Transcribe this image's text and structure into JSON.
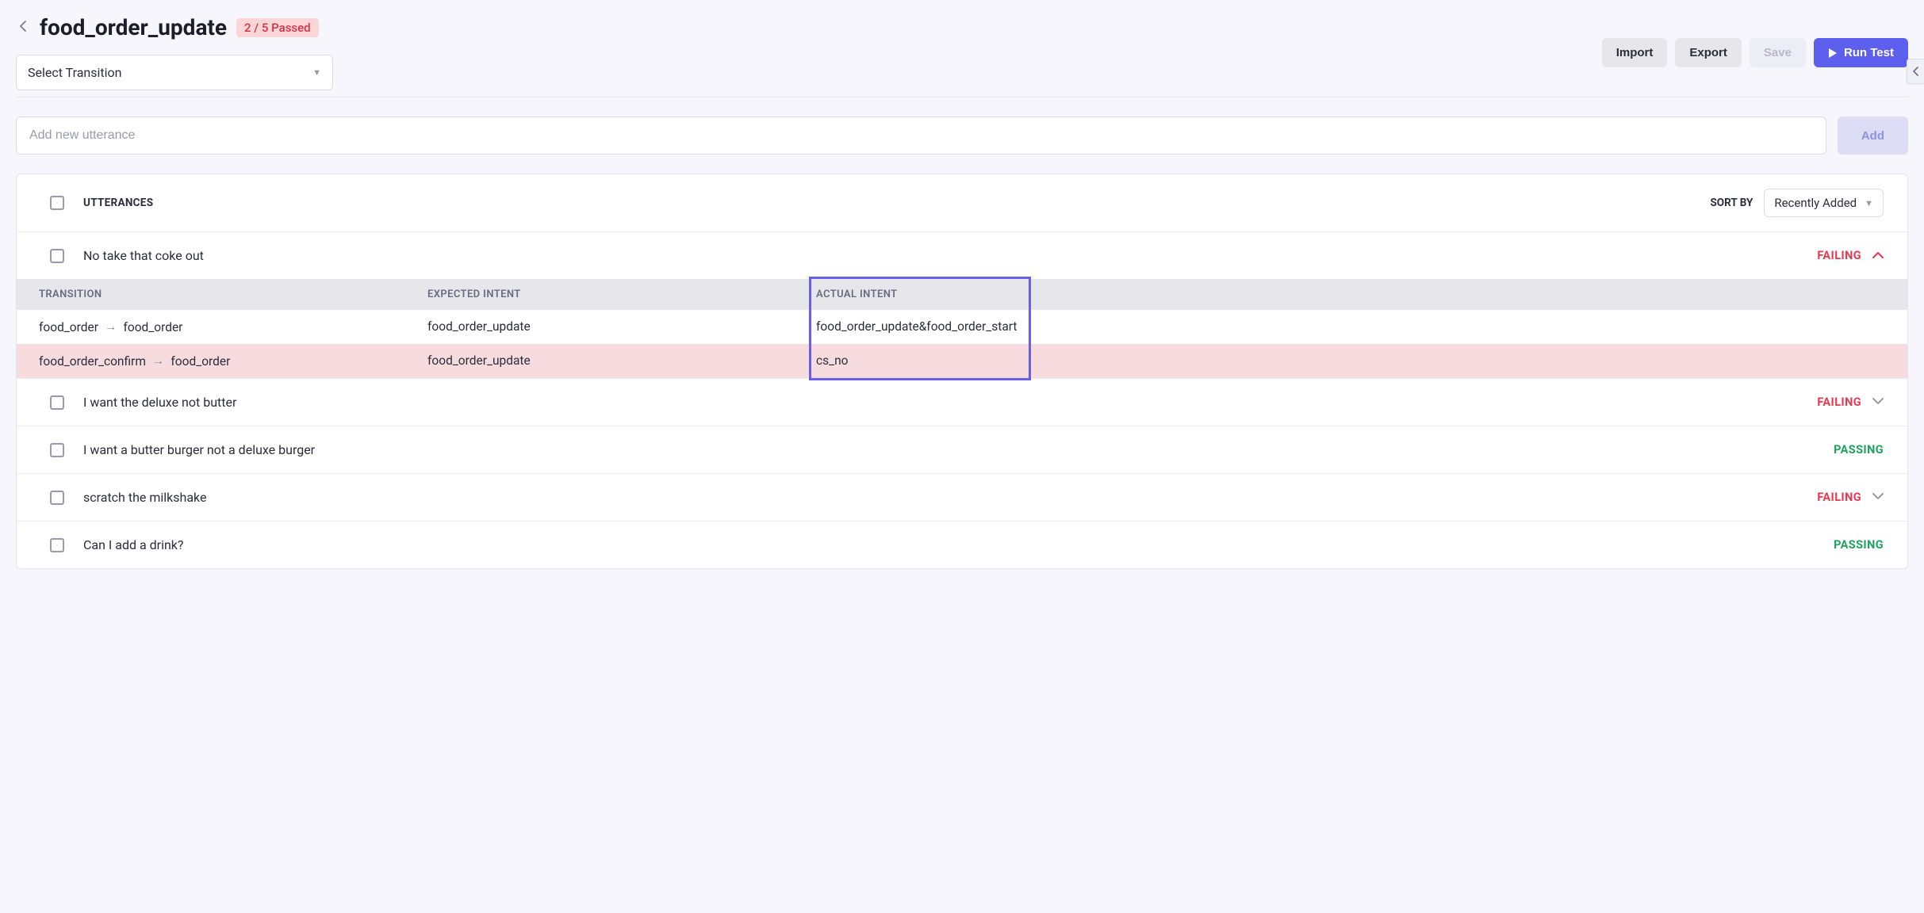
{
  "header": {
    "title": "food_order_update",
    "pass_badge": "2 / 5 Passed",
    "import_label": "Import",
    "export_label": "Export",
    "save_label": "Save",
    "run_label": "Run Test"
  },
  "transition_select": {
    "placeholder": "Select Transition"
  },
  "add": {
    "input_placeholder": "Add new utterance",
    "button_label": "Add"
  },
  "table": {
    "utterances_label": "UTTERANCES",
    "sort_by_label": "SORT BY",
    "sort_value": "Recently Added",
    "detail_headers": {
      "transition": "TRANSITION",
      "expected": "EXPECTED INTENT",
      "actual": "ACTUAL INTENT"
    }
  },
  "status_labels": {
    "failing": "FAILING",
    "passing": "PASSING"
  },
  "utterances": [
    {
      "text": "No take that coke out",
      "status": "failing",
      "expanded": true
    },
    {
      "text": "I want the deluxe not butter",
      "status": "failing",
      "expanded": false
    },
    {
      "text": "I want a butter burger not a deluxe burger",
      "status": "passing",
      "expanded": false
    },
    {
      "text": "scratch the milkshake",
      "status": "failing",
      "expanded": false
    },
    {
      "text": "Can I add a drink?",
      "status": "passing",
      "expanded": false
    }
  ],
  "details": [
    {
      "from": "food_order",
      "to": "food_order",
      "expected": "food_order_update",
      "actual": "food_order_update&food_order_start",
      "error": false
    },
    {
      "from": "food_order_confirm",
      "to": "food_order",
      "expected": "food_order_update",
      "actual": "cs_no",
      "error": true
    }
  ]
}
